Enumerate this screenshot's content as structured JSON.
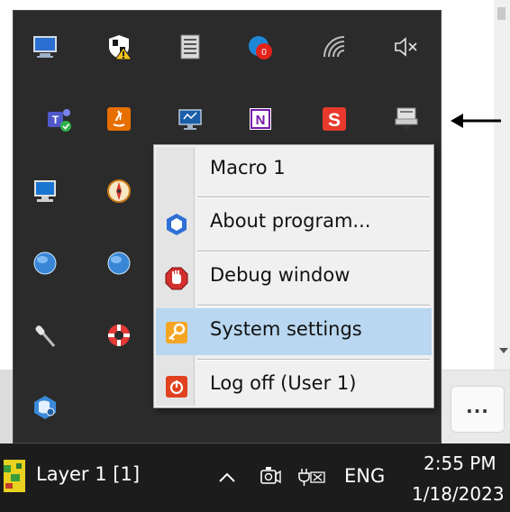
{
  "tray_overflow": {
    "icons": [
      {
        "name": "monitor-icon"
      },
      {
        "name": "security-shield-warning-icon"
      },
      {
        "name": "server-icon"
      },
      {
        "name": "notification-badge-icon",
        "badge": "0"
      },
      {
        "name": "wifi-icon"
      },
      {
        "name": "volume-muted-icon"
      },
      {
        "name": "teams-icon"
      },
      {
        "name": "java-icon"
      },
      {
        "name": "remote-desktop-icon"
      },
      {
        "name": "onenote-icon"
      },
      {
        "name": "s-app-icon"
      },
      {
        "name": "print-queue-icon"
      },
      {
        "name": "computer-icon"
      },
      {
        "name": "compass-icon"
      },
      {
        "name": "globe-icon"
      },
      {
        "name": "globe-icon"
      },
      {
        "name": "microphone-icon"
      },
      {
        "name": "lifebuoy-icon"
      },
      {
        "name": "database-icon"
      }
    ]
  },
  "context_menu": {
    "items": [
      {
        "label": "Macro 1"
      },
      {
        "label": "About program...",
        "icon": "hexagon-icon"
      },
      {
        "label": "Debug window",
        "icon": "stop-hand-icon"
      },
      {
        "label": "System settings",
        "icon": "key-icon"
      },
      {
        "label": "Log off (User 1)",
        "icon": "logoff-icon"
      }
    ],
    "highlighted_index": 3
  },
  "background": {
    "more_button_label": "..."
  },
  "taskbar": {
    "app_label": "Layer 1 [1]",
    "language": "ENG",
    "clock_time": "2:55 PM",
    "clock_date": "1/18/2023"
  },
  "colors": {
    "tray_background": "#2b2b2b",
    "taskbar_background": "#1c1c1c",
    "menu_highlight": "#b9d7f0"
  }
}
